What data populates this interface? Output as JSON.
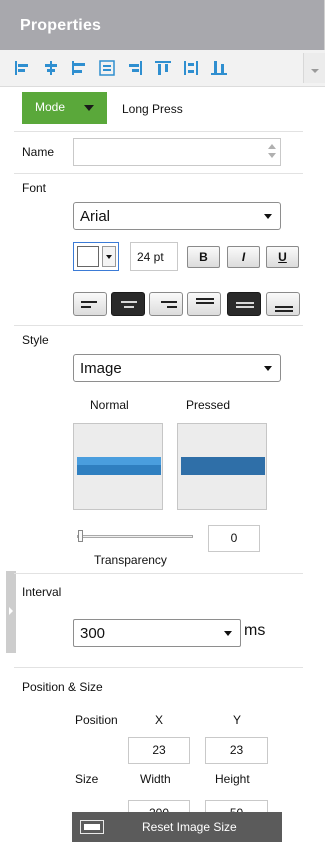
{
  "header": {
    "title": "Properties"
  },
  "align_toolbar": {
    "buttons": [
      {
        "icon": "align-left-icon"
      },
      {
        "icon": "align-center-horizontal-icon"
      },
      {
        "icon": "align-left-edge-icon"
      },
      {
        "icon": "distribute-horizontal-icon"
      },
      {
        "icon": "align-right-icon"
      },
      {
        "icon": "align-top-icon"
      },
      {
        "icon": "distribute-vertical-icon"
      },
      {
        "icon": "align-bottom-icon"
      }
    ],
    "accent_color": "#2f8fd0"
  },
  "mode": {
    "button_label": "Mode",
    "value": "Long Press",
    "color": "#5aa83a"
  },
  "name": {
    "label": "Name",
    "value": ""
  },
  "font": {
    "label": "Font",
    "family": "Arial",
    "size": "24 pt",
    "bold_label": "B",
    "italic_label": "I",
    "underline_label": "U",
    "alignment_buttons": [
      "align-left",
      "align-center",
      "align-right",
      "align-top",
      "align-middle",
      "align-bottom"
    ],
    "selected_horizontal": "align-center",
    "selected_vertical": "align-middle"
  },
  "style": {
    "label": "Style",
    "value": "Image",
    "normal_label": "Normal",
    "pressed_label": "Pressed",
    "normal_color": "#3c8fd0",
    "pressed_color": "#2f6fa8"
  },
  "transparency": {
    "label": "Transparency",
    "value": "0",
    "level": 0
  },
  "interval": {
    "label": "Interval",
    "value": "300",
    "unit": "ms"
  },
  "position_size": {
    "label": "Position & Size",
    "position_label": "Position",
    "x_label": "X",
    "y_label": "Y",
    "x_value": "23",
    "y_value": "23",
    "size_label": "Size",
    "width_label": "Width",
    "height_label": "Height",
    "width_value": "200",
    "height_value": "50"
  },
  "reset_button": {
    "label": "Reset Image Size"
  }
}
